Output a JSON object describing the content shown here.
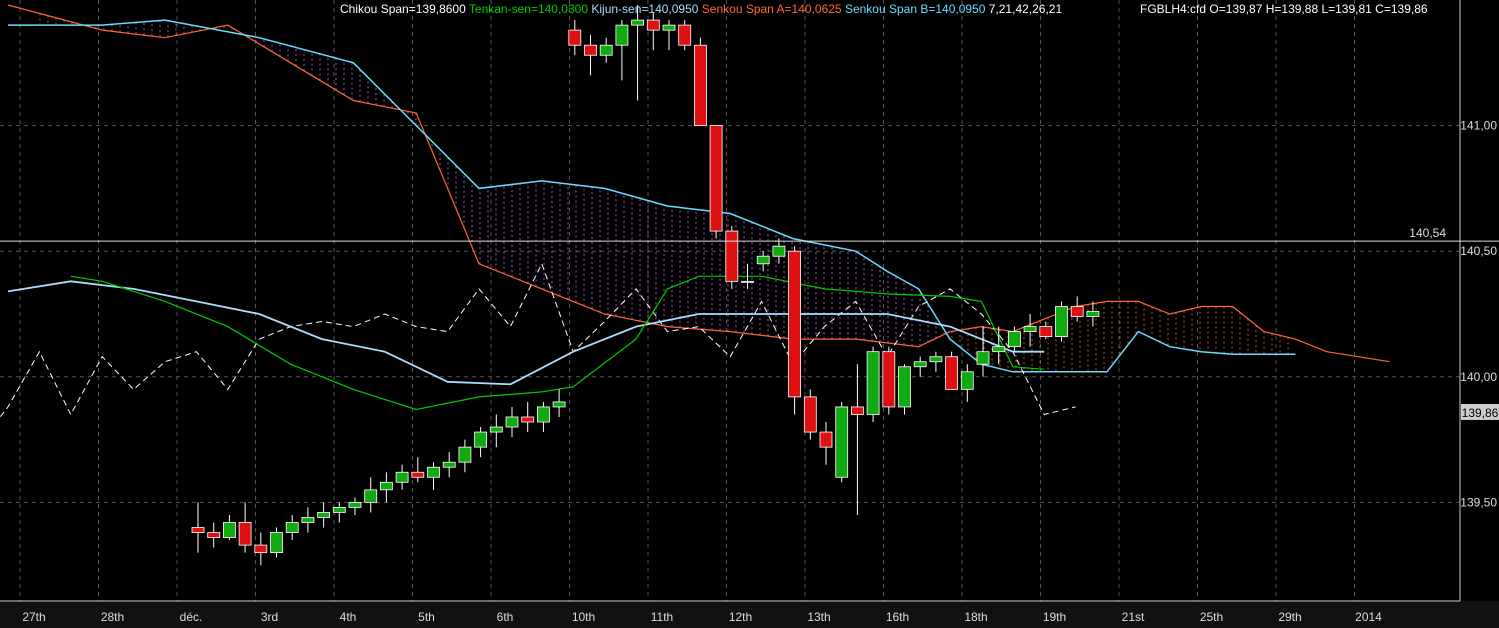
{
  "chart_data": {
    "type": "candlestick",
    "instrument": "FGBLH4:cfd",
    "ohlc_summary": {
      "open": "139,87",
      "high": "139,88",
      "low": "139,81",
      "close": "139,86"
    },
    "ohlc_label": "FGBLH4:cfd O=139,87 H=139,88 L=139,81 C=139,86",
    "indicator_params": "7,21,42,26,21",
    "legend": [
      {
        "label": "Chikou Span=139,8600",
        "color": "#ffffff"
      },
      {
        "label": "Tenkan-sen=140,0300",
        "color": "#00cc00"
      },
      {
        "label": "Kijun-sen=140,0950",
        "color": "#aaddff"
      },
      {
        "label": "Senkou Span A=140,0625",
        "color": "#ff6633"
      },
      {
        "label": "Senkou Span B=140,0950",
        "color": "#66ddff"
      }
    ],
    "y_ticks": [
      139.5,
      140.0,
      140.5,
      141.0
    ],
    "y_tick_labels": [
      "139,50",
      "140,00",
      "140,50",
      "141,00"
    ],
    "ylim": [
      139.0,
      141.5
    ],
    "x_ticks": [
      "27th",
      "28th",
      "déc.",
      "3rd",
      "4th",
      "5th",
      "6th",
      "10th",
      "11th",
      "12th",
      "13th",
      "16th",
      "18th",
      "19th",
      "21st",
      "25th",
      "29th",
      "2014"
    ],
    "hline": {
      "value": 140.54,
      "label": "140,54"
    },
    "last_price": {
      "value": 139.86,
      "label": "139,86"
    },
    "candles": [
      [
        139.4,
        139.5,
        139.3,
        139.38
      ],
      [
        139.38,
        139.42,
        139.32,
        139.36
      ],
      [
        139.36,
        139.45,
        139.35,
        139.42
      ],
      [
        139.42,
        139.5,
        139.3,
        139.33
      ],
      [
        139.33,
        139.38,
        139.25,
        139.3
      ],
      [
        139.3,
        139.4,
        139.28,
        139.38
      ],
      [
        139.38,
        139.45,
        139.35,
        139.42
      ],
      [
        139.42,
        139.48,
        139.38,
        139.44
      ],
      [
        139.44,
        139.5,
        139.4,
        139.46
      ],
      [
        139.46,
        139.5,
        139.42,
        139.48
      ],
      [
        139.48,
        139.52,
        139.45,
        139.5
      ],
      [
        139.5,
        139.6,
        139.46,
        139.55
      ],
      [
        139.55,
        139.62,
        139.5,
        139.58
      ],
      [
        139.58,
        139.65,
        139.55,
        139.62
      ],
      [
        139.62,
        139.68,
        139.58,
        139.6
      ],
      [
        139.6,
        139.66,
        139.55,
        139.64
      ],
      [
        139.64,
        139.7,
        139.6,
        139.66
      ],
      [
        139.66,
        139.75,
        139.62,
        139.72
      ],
      [
        139.72,
        139.8,
        139.68,
        139.78
      ],
      [
        139.78,
        139.85,
        139.72,
        139.8
      ],
      [
        139.8,
        139.88,
        139.76,
        139.84
      ],
      [
        139.84,
        139.9,
        139.78,
        139.82
      ],
      [
        139.82,
        139.9,
        139.78,
        139.88
      ],
      [
        139.88,
        139.95,
        139.84,
        139.9
      ],
      [
        141.38,
        141.42,
        141.28,
        141.32
      ],
      [
        141.32,
        141.36,
        141.2,
        141.28
      ],
      [
        141.28,
        141.35,
        141.25,
        141.32
      ],
      [
        141.32,
        141.42,
        141.18,
        141.4
      ],
      [
        141.4,
        141.48,
        141.1,
        141.42
      ],
      [
        141.42,
        141.45,
        141.3,
        141.38
      ],
      [
        141.38,
        141.42,
        141.3,
        141.4
      ],
      [
        141.4,
        141.42,
        141.3,
        141.32
      ],
      [
        141.32,
        141.35,
        141.05,
        141.0
      ],
      [
        141.0,
        141.0,
        140.55,
        140.58
      ],
      [
        140.58,
        140.6,
        140.35,
        140.38
      ],
      [
        140.38,
        140.45,
        140.35,
        140.38
      ],
      [
        140.45,
        140.5,
        140.42,
        140.48
      ],
      [
        140.48,
        140.55,
        140.45,
        140.52
      ],
      [
        140.5,
        140.52,
        139.85,
        139.92
      ],
      [
        139.92,
        139.95,
        139.75,
        139.78
      ],
      [
        139.78,
        139.82,
        139.65,
        139.72
      ],
      [
        139.6,
        139.9,
        139.58,
        139.88
      ],
      [
        139.88,
        140.05,
        139.45,
        139.85
      ],
      [
        139.85,
        140.12,
        139.82,
        140.1
      ],
      [
        140.1,
        140.12,
        139.85,
        139.88
      ],
      [
        139.88,
        140.05,
        139.85,
        140.04
      ],
      [
        140.04,
        140.08,
        140.0,
        140.06
      ],
      [
        140.06,
        140.1,
        140.02,
        140.08
      ],
      [
        140.08,
        140.1,
        139.95,
        139.95
      ],
      [
        139.95,
        140.05,
        139.9,
        140.02
      ],
      [
        140.05,
        140.2,
        140.0,
        140.1
      ],
      [
        140.1,
        140.2,
        140.05,
        140.12
      ],
      [
        140.12,
        140.2,
        140.1,
        140.18
      ],
      [
        140.18,
        140.25,
        140.12,
        140.2
      ],
      [
        140.2,
        140.22,
        140.15,
        140.16
      ],
      [
        140.16,
        140.3,
        140.14,
        140.28
      ],
      [
        140.28,
        140.32,
        140.22,
        140.24
      ],
      [
        140.24,
        140.3,
        140.2,
        140.26
      ],
      [
        140.26,
        140.28,
        140.2,
        140.22
      ],
      [
        140.22,
        140.45,
        140.05,
        140.14
      ],
      [
        140.14,
        140.35,
        140.05,
        140.05
      ],
      [
        140.05,
        140.35,
        140.0,
        140.35
      ],
      [
        140.35,
        140.38,
        140.1,
        140.08
      ],
      [
        140.1,
        140.25,
        140.05,
        140.22
      ],
      [
        140.22,
        140.28,
        140.12,
        140.15
      ],
      [
        140.15,
        140.2,
        140.12,
        140.14
      ],
      [
        140.15,
        140.18,
        140.05,
        140.08
      ],
      [
        140.08,
        140.25,
        140.02,
        140.2
      ],
      [
        140.2,
        140.28,
        140.15,
        140.26
      ],
      [
        140.26,
        140.32,
        140.22,
        140.29
      ],
      [
        140.56,
        140.58,
        140.22,
        140.3
      ],
      [
        140.38,
        140.4,
        140.2,
        140.25
      ],
      [
        140.25,
        140.3,
        140.15,
        140.22
      ],
      [
        140.22,
        140.25,
        140.15,
        140.16
      ],
      [
        140.16,
        140.2,
        140.12,
        140.18
      ],
      [
        140.22,
        140.38,
        140.2,
        140.38
      ],
      [
        140.38,
        140.42,
        140.2,
        140.22
      ],
      [
        140.25,
        140.4,
        140.22,
        140.38
      ],
      [
        140.38,
        140.42,
        140.3,
        140.35
      ],
      [
        140.38,
        140.4,
        140.3,
        140.31
      ],
      [
        140.31,
        140.45,
        140.28,
        140.42
      ],
      [
        140.42,
        140.45,
        140.2,
        140.25
      ],
      [
        140.2,
        140.22,
        139.95,
        140.18
      ],
      [
        140.18,
        140.2,
        139.8,
        139.85
      ],
      [
        139.85,
        140.02,
        139.82,
        139.98
      ],
      [
        140.0,
        140.02,
        139.62,
        139.83
      ],
      [
        139.83,
        139.88,
        139.75,
        139.86
      ],
      [
        139.86,
        139.88,
        139.81,
        139.86
      ]
    ],
    "tenkan": [
      [
        2,
        140.4
      ],
      [
        3,
        140.38
      ],
      [
        5,
        140.3
      ],
      [
        7,
        140.2
      ],
      [
        9,
        140.05
      ],
      [
        11,
        139.95
      ],
      [
        13,
        139.87
      ],
      [
        15,
        139.92
      ],
      [
        17,
        139.94
      ],
      [
        18,
        139.96
      ],
      [
        20,
        140.15
      ],
      [
        21,
        140.35
      ],
      [
        22,
        140.4
      ],
      [
        24,
        140.4
      ],
      [
        26,
        140.35
      ],
      [
        28,
        140.33
      ],
      [
        30,
        140.32
      ],
      [
        31,
        140.3
      ],
      [
        32,
        140.04
      ],
      [
        33,
        140.03
      ]
    ],
    "kijun": [
      [
        0,
        140.34
      ],
      [
        2,
        140.38
      ],
      [
        4,
        140.35
      ],
      [
        6,
        140.3
      ],
      [
        8,
        140.25
      ],
      [
        10,
        140.15
      ],
      [
        12,
        140.1
      ],
      [
        14,
        139.98
      ],
      [
        16,
        139.97
      ],
      [
        18,
        140.1
      ],
      [
        20,
        140.2
      ],
      [
        22,
        140.25
      ],
      [
        24,
        140.25
      ],
      [
        26,
        140.25
      ],
      [
        28,
        140.25
      ],
      [
        30,
        140.2
      ],
      [
        31,
        140.15
      ],
      [
        32,
        140.1
      ],
      [
        33,
        140.1
      ]
    ],
    "senkou_a": [
      [
        0,
        141.48
      ],
      [
        3,
        141.38
      ],
      [
        5,
        141.35
      ],
      [
        7,
        141.4
      ],
      [
        9,
        141.25
      ],
      [
        11,
        141.1
      ],
      [
        13,
        141.05
      ],
      [
        15,
        140.45
      ],
      [
        17,
        140.35
      ],
      [
        19,
        140.25
      ],
      [
        21,
        140.2
      ],
      [
        23,
        140.18
      ],
      [
        25,
        140.15
      ],
      [
        27,
        140.15
      ],
      [
        29,
        140.12
      ],
      [
        30,
        140.18
      ],
      [
        31,
        140.2
      ],
      [
        32,
        140.18
      ],
      [
        34,
        140.28
      ],
      [
        35,
        140.3
      ],
      [
        36,
        140.3
      ],
      [
        37,
        140.25
      ],
      [
        38,
        140.28
      ],
      [
        39,
        140.28
      ],
      [
        40,
        140.18
      ],
      [
        41,
        140.15
      ],
      [
        42,
        140.1
      ],
      [
        43,
        140.08
      ],
      [
        44,
        140.06
      ]
    ],
    "senkou_b": [
      [
        0,
        141.4
      ],
      [
        3,
        141.4
      ],
      [
        5,
        141.42
      ],
      [
        8,
        141.35
      ],
      [
        11,
        141.25
      ],
      [
        13,
        141.0
      ],
      [
        15,
        140.75
      ],
      [
        17,
        140.78
      ],
      [
        19,
        140.75
      ],
      [
        21,
        140.68
      ],
      [
        23,
        140.65
      ],
      [
        25,
        140.55
      ],
      [
        27,
        140.5
      ],
      [
        28,
        140.42
      ],
      [
        29,
        140.35
      ],
      [
        30,
        140.15
      ],
      [
        31,
        140.05
      ],
      [
        32,
        140.02
      ],
      [
        33,
        140.02
      ],
      [
        34,
        140.02
      ],
      [
        35,
        140.02
      ],
      [
        36,
        140.18
      ],
      [
        37,
        140.12
      ],
      [
        38,
        140.1
      ],
      [
        39,
        140.09
      ],
      [
        40,
        140.09
      ],
      [
        41,
        140.09
      ]
    ],
    "chikou": [
      [
        -5,
        140.42
      ],
      [
        -4,
        140.38
      ],
      [
        -3,
        140.52
      ],
      [
        -2,
        140.0
      ],
      [
        -1,
        139.72
      ],
      [
        0,
        139.88
      ],
      [
        1,
        140.1
      ],
      [
        2,
        139.85
      ],
      [
        3,
        140.08
      ],
      [
        4,
        139.95
      ],
      [
        5,
        140.06
      ],
      [
        6,
        140.1
      ],
      [
        7,
        139.95
      ],
      [
        8,
        140.15
      ],
      [
        9,
        140.2
      ],
      [
        10,
        140.22
      ],
      [
        11,
        140.2
      ],
      [
        12,
        140.25
      ],
      [
        13,
        140.2
      ],
      [
        14,
        140.18
      ],
      [
        15,
        140.35
      ],
      [
        16,
        140.2
      ],
      [
        17,
        140.45
      ],
      [
        18,
        140.1
      ],
      [
        19,
        140.22
      ],
      [
        20,
        140.35
      ],
      [
        21,
        140.18
      ],
      [
        22,
        140.2
      ],
      [
        23,
        140.08
      ],
      [
        24,
        140.3
      ],
      [
        25,
        140.05
      ],
      [
        26,
        140.2
      ],
      [
        27,
        140.3
      ],
      [
        28,
        140.08
      ],
      [
        29,
        140.28
      ],
      [
        30,
        140.35
      ],
      [
        31,
        140.25
      ],
      [
        32,
        140.1
      ],
      [
        33,
        139.85
      ],
      [
        34,
        139.88
      ]
    ]
  }
}
